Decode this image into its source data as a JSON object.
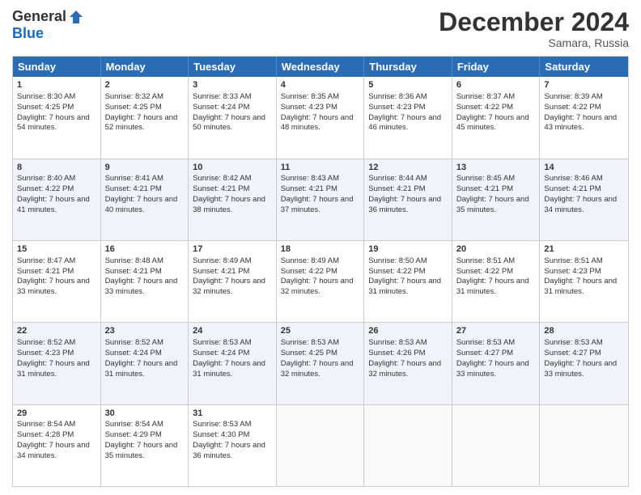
{
  "logo": {
    "general": "General",
    "blue": "Blue"
  },
  "title": {
    "month": "December 2024",
    "location": "Samara, Russia"
  },
  "headers": [
    "Sunday",
    "Monday",
    "Tuesday",
    "Wednesday",
    "Thursday",
    "Friday",
    "Saturday"
  ],
  "weeks": [
    [
      {
        "day": "1",
        "sunrise": "8:30 AM",
        "sunset": "4:25 PM",
        "daylight": "7 hours and 54 minutes."
      },
      {
        "day": "2",
        "sunrise": "8:32 AM",
        "sunset": "4:25 PM",
        "daylight": "7 hours and 52 minutes."
      },
      {
        "day": "3",
        "sunrise": "8:33 AM",
        "sunset": "4:24 PM",
        "daylight": "7 hours and 50 minutes."
      },
      {
        "day": "4",
        "sunrise": "8:35 AM",
        "sunset": "4:23 PM",
        "daylight": "7 hours and 48 minutes."
      },
      {
        "day": "5",
        "sunrise": "8:36 AM",
        "sunset": "4:23 PM",
        "daylight": "7 hours and 46 minutes."
      },
      {
        "day": "6",
        "sunrise": "8:37 AM",
        "sunset": "4:22 PM",
        "daylight": "7 hours and 45 minutes."
      },
      {
        "day": "7",
        "sunrise": "8:39 AM",
        "sunset": "4:22 PM",
        "daylight": "7 hours and 43 minutes."
      }
    ],
    [
      {
        "day": "8",
        "sunrise": "8:40 AM",
        "sunset": "4:22 PM",
        "daylight": "7 hours and 41 minutes."
      },
      {
        "day": "9",
        "sunrise": "8:41 AM",
        "sunset": "4:21 PM",
        "daylight": "7 hours and 40 minutes."
      },
      {
        "day": "10",
        "sunrise": "8:42 AM",
        "sunset": "4:21 PM",
        "daylight": "7 hours and 38 minutes."
      },
      {
        "day": "11",
        "sunrise": "8:43 AM",
        "sunset": "4:21 PM",
        "daylight": "7 hours and 37 minutes."
      },
      {
        "day": "12",
        "sunrise": "8:44 AM",
        "sunset": "4:21 PM",
        "daylight": "7 hours and 36 minutes."
      },
      {
        "day": "13",
        "sunrise": "8:45 AM",
        "sunset": "4:21 PM",
        "daylight": "7 hours and 35 minutes."
      },
      {
        "day": "14",
        "sunrise": "8:46 AM",
        "sunset": "4:21 PM",
        "daylight": "7 hours and 34 minutes."
      }
    ],
    [
      {
        "day": "15",
        "sunrise": "8:47 AM",
        "sunset": "4:21 PM",
        "daylight": "7 hours and 33 minutes."
      },
      {
        "day": "16",
        "sunrise": "8:48 AM",
        "sunset": "4:21 PM",
        "daylight": "7 hours and 33 minutes."
      },
      {
        "day": "17",
        "sunrise": "8:49 AM",
        "sunset": "4:21 PM",
        "daylight": "7 hours and 32 minutes."
      },
      {
        "day": "18",
        "sunrise": "8:49 AM",
        "sunset": "4:22 PM",
        "daylight": "7 hours and 32 minutes."
      },
      {
        "day": "19",
        "sunrise": "8:50 AM",
        "sunset": "4:22 PM",
        "daylight": "7 hours and 31 minutes."
      },
      {
        "day": "20",
        "sunrise": "8:51 AM",
        "sunset": "4:22 PM",
        "daylight": "7 hours and 31 minutes."
      },
      {
        "day": "21",
        "sunrise": "8:51 AM",
        "sunset": "4:23 PM",
        "daylight": "7 hours and 31 minutes."
      }
    ],
    [
      {
        "day": "22",
        "sunrise": "8:52 AM",
        "sunset": "4:23 PM",
        "daylight": "7 hours and 31 minutes."
      },
      {
        "day": "23",
        "sunrise": "8:52 AM",
        "sunset": "4:24 PM",
        "daylight": "7 hours and 31 minutes."
      },
      {
        "day": "24",
        "sunrise": "8:53 AM",
        "sunset": "4:24 PM",
        "daylight": "7 hours and 31 minutes."
      },
      {
        "day": "25",
        "sunrise": "8:53 AM",
        "sunset": "4:25 PM",
        "daylight": "7 hours and 32 minutes."
      },
      {
        "day": "26",
        "sunrise": "8:53 AM",
        "sunset": "4:26 PM",
        "daylight": "7 hours and 32 minutes."
      },
      {
        "day": "27",
        "sunrise": "8:53 AM",
        "sunset": "4:27 PM",
        "daylight": "7 hours and 33 minutes."
      },
      {
        "day": "28",
        "sunrise": "8:53 AM",
        "sunset": "4:27 PM",
        "daylight": "7 hours and 33 minutes."
      }
    ],
    [
      {
        "day": "29",
        "sunrise": "8:54 AM",
        "sunset": "4:28 PM",
        "daylight": "7 hours and 34 minutes."
      },
      {
        "day": "30",
        "sunrise": "8:54 AM",
        "sunset": "4:29 PM",
        "daylight": "7 hours and 35 minutes."
      },
      {
        "day": "31",
        "sunrise": "8:53 AM",
        "sunset": "4:30 PM",
        "daylight": "7 hours and 36 minutes."
      },
      null,
      null,
      null,
      null
    ]
  ]
}
